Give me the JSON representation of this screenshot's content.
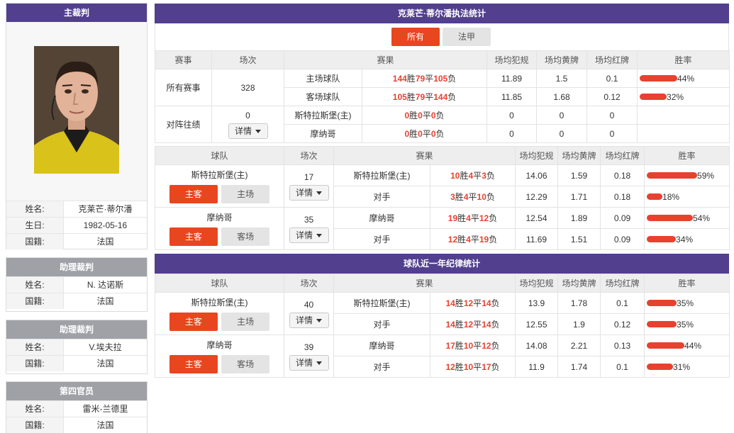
{
  "referee": {
    "header": "主裁判",
    "name_label": "姓名:",
    "name": "克莱芒·蒂尔潘",
    "birth_label": "生日:",
    "birth": "1982-05-16",
    "nation_label": "国籍:",
    "nation": "法国"
  },
  "assistant1": {
    "header": "助理裁判",
    "name_label": "姓名:",
    "name": "N. 达诺斯",
    "nation_label": "国籍:",
    "nation": "法国"
  },
  "assistant2": {
    "header": "助理裁判",
    "name_label": "姓名:",
    "name": "V.埃夫拉",
    "nation_label": "国籍:",
    "nation": "法国"
  },
  "fourth": {
    "header": "第四官员",
    "name_label": "姓名:",
    "name": "雷米-兰德里",
    "nation_label": "国籍:",
    "nation": "法国"
  },
  "panel1": {
    "title": "克莱芒·蒂尔潘执法统计",
    "tabs": [
      {
        "label": "所有",
        "active": true
      },
      {
        "label": "法甲",
        "active": false
      }
    ],
    "headers": [
      "赛事",
      "场次",
      "赛果",
      "场均犯规",
      "场均黄牌",
      "场均红牌",
      "胜率"
    ],
    "all": {
      "label": "所有赛事",
      "matches": "328",
      "rows": [
        {
          "side": "主场球队",
          "w": "144",
          "wl": "胜",
          "d": "79",
          "dl": "平",
          "l": "105",
          "ll": "负",
          "fouls": "11.89",
          "yellow": "1.5",
          "red": "0.1",
          "rate": 44,
          "rate_text": "44%"
        },
        {
          "side": "客场球队",
          "w": "105",
          "wl": "胜",
          "d": "79",
          "dl": "平",
          "l": "144",
          "ll": "负",
          "fouls": "11.85",
          "yellow": "1.68",
          "red": "0.12",
          "rate": 32,
          "rate_text": "32%"
        }
      ]
    },
    "h2h": {
      "label": "对阵往绩",
      "matches": "0",
      "detail": "详情",
      "rows": [
        {
          "side": "斯特拉斯堡(主)",
          "w": "0",
          "wl": "胜",
          "d": "0",
          "dl": "平",
          "l": "0",
          "ll": "负",
          "fouls": "0",
          "yellow": "0",
          "red": "0"
        },
        {
          "side": "摩纳哥",
          "w": "0",
          "wl": "胜",
          "d": "0",
          "dl": "平",
          "l": "0",
          "ll": "负",
          "fouls": "0",
          "yellow": "0",
          "red": "0"
        }
      ]
    }
  },
  "panel2": {
    "headers": [
      "球队",
      "场次",
      "赛果",
      "场均犯规",
      "场均黄牌",
      "场均红牌",
      "胜率"
    ],
    "teams": [
      {
        "name": "斯特拉斯堡(主)",
        "btn_active": "主客",
        "btn_other": "主场",
        "matches": "17",
        "detail": "详情",
        "rows": [
          {
            "side": "斯特拉斯堡(主)",
            "w": "10",
            "wl": "胜",
            "d": "4",
            "dl": "平",
            "l": "3",
            "ll": "负",
            "fouls": "14.06",
            "yellow": "1.59",
            "red": "0.18",
            "rate": 59,
            "rate_text": "59%"
          },
          {
            "side": "对手",
            "w": "3",
            "wl": "胜",
            "d": "4",
            "dl": "平",
            "l": "10",
            "ll": "负",
            "fouls": "12.29",
            "yellow": "1.71",
            "red": "0.18",
            "rate": 18,
            "rate_text": "18%"
          }
        ]
      },
      {
        "name": "摩纳哥",
        "btn_active": "主客",
        "btn_other": "客场",
        "matches": "35",
        "detail": "详情",
        "rows": [
          {
            "side": "摩纳哥",
            "w": "19",
            "wl": "胜",
            "d": "4",
            "dl": "平",
            "l": "12",
            "ll": "负",
            "fouls": "12.54",
            "yellow": "1.89",
            "red": "0.09",
            "rate": 54,
            "rate_text": "54%"
          },
          {
            "side": "对手",
            "w": "12",
            "wl": "胜",
            "d": "4",
            "dl": "平",
            "l": "19",
            "ll": "负",
            "fouls": "11.69",
            "yellow": "1.51",
            "red": "0.09",
            "rate": 34,
            "rate_text": "34%"
          }
        ]
      }
    ]
  },
  "panel3": {
    "title": "球队近一年纪律统计",
    "headers": [
      "球队",
      "场次",
      "赛果",
      "场均犯规",
      "场均黄牌",
      "场均红牌",
      "胜率"
    ],
    "teams": [
      {
        "name": "斯特拉斯堡(主)",
        "btn_active": "主客",
        "btn_other": "主场",
        "matches": "40",
        "detail": "详情",
        "rows": [
          {
            "side": "斯特拉斯堡(主)",
            "w": "14",
            "wl": "胜",
            "d": "12",
            "dl": "平",
            "l": "14",
            "ll": "负",
            "fouls": "13.9",
            "yellow": "1.78",
            "red": "0.1",
            "rate": 35,
            "rate_text": "35%"
          },
          {
            "side": "对手",
            "w": "14",
            "wl": "胜",
            "d": "12",
            "dl": "平",
            "l": "14",
            "ll": "负",
            "fouls": "12.55",
            "yellow": "1.9",
            "red": "0.12",
            "rate": 35,
            "rate_text": "35%"
          }
        ]
      },
      {
        "name": "摩纳哥",
        "btn_active": "主客",
        "btn_other": "客场",
        "matches": "39",
        "detail": "详情",
        "rows": [
          {
            "side": "摩纳哥",
            "w": "17",
            "wl": "胜",
            "d": "10",
            "dl": "平",
            "l": "12",
            "ll": "负",
            "fouls": "14.08",
            "yellow": "2.21",
            "red": "0.13",
            "rate": 44,
            "rate_text": "44%"
          },
          {
            "side": "对手",
            "w": "12",
            "wl": "胜",
            "d": "10",
            "dl": "平",
            "l": "17",
            "ll": "负",
            "fouls": "11.9",
            "yellow": "1.74",
            "red": "0.1",
            "rate": 31,
            "rate_text": "31%"
          }
        ]
      }
    ]
  },
  "colors": {
    "header": "#523f8e",
    "accent": "#e8412f",
    "grey_header": "#9fa1a7"
  }
}
